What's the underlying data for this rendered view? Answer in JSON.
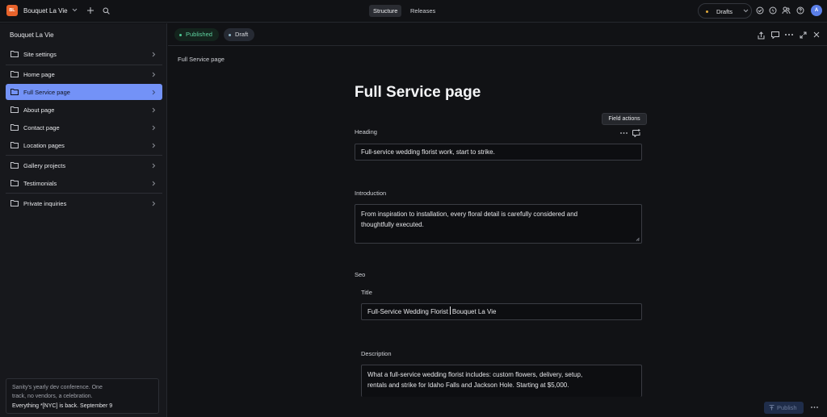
{
  "topbar": {
    "logo_text": "BL",
    "workspace_name": "Bouquet La Vie",
    "tabs": [
      {
        "label": "Structure",
        "active": true
      },
      {
        "label": "Releases",
        "active": false
      }
    ],
    "perspective": "Drafts",
    "avatar_initial": "A",
    "colors": {
      "logo": "#e8632b",
      "avatar": "#5b7fe8",
      "drafts_dot": "#e0a93b"
    }
  },
  "sidebar": {
    "title": "Bouquet La Vie",
    "items": [
      {
        "label": "Site settings",
        "icon": "folder-icon",
        "active": false
      },
      {
        "label": "Home page",
        "icon": "folder-icon",
        "active": false
      },
      {
        "label": "Full Service page",
        "icon": "folder-icon",
        "active": true
      },
      {
        "label": "About page",
        "icon": "folder-icon",
        "active": false
      },
      {
        "label": "Contact page",
        "icon": "folder-icon",
        "active": false
      },
      {
        "label": "Location pages",
        "icon": "folder-icon",
        "active": false
      },
      {
        "label": "Gallery projects",
        "icon": "folder-icon",
        "active": false
      },
      {
        "label": "Testimonials",
        "icon": "folder-icon",
        "active": false
      },
      {
        "label": "Private inquiries",
        "icon": "folder-icon",
        "active": false
      }
    ],
    "active_color": "#7392f7",
    "promo": {
      "line1": "Sanity's yearly dev conference. One",
      "line2": "track, no vendors, a celebration.",
      "line3": "Everything *[NYC] is back. September 9"
    }
  },
  "document": {
    "status": {
      "published": "Published",
      "draft": "Draft"
    },
    "breadcrumb": "Full Service page",
    "title": "Full Service page",
    "tooltip": "Field actions",
    "heading": {
      "label": "Heading",
      "value": "Full-service wedding florist work, start to strike."
    },
    "introduction": {
      "label": "Introduction",
      "value_line1": "From inspiration to installation, every floral detail is carefully considered and",
      "value_line2": "thoughtfully executed."
    },
    "seo": {
      "label": "Seo",
      "title_label": "Title",
      "title_before_caret": "Full-Service Wedding Florist",
      "title_after_caret": "Bouquet La Vie",
      "description_label": "Description",
      "description_line1": "What a full-service wedding florist includes: custom flowers, delivery, setup,",
      "description_line2": "rentals and strike for Idaho Falls and Jackson Hole. Starting at $5,000."
    },
    "publish_label": "Publish"
  }
}
